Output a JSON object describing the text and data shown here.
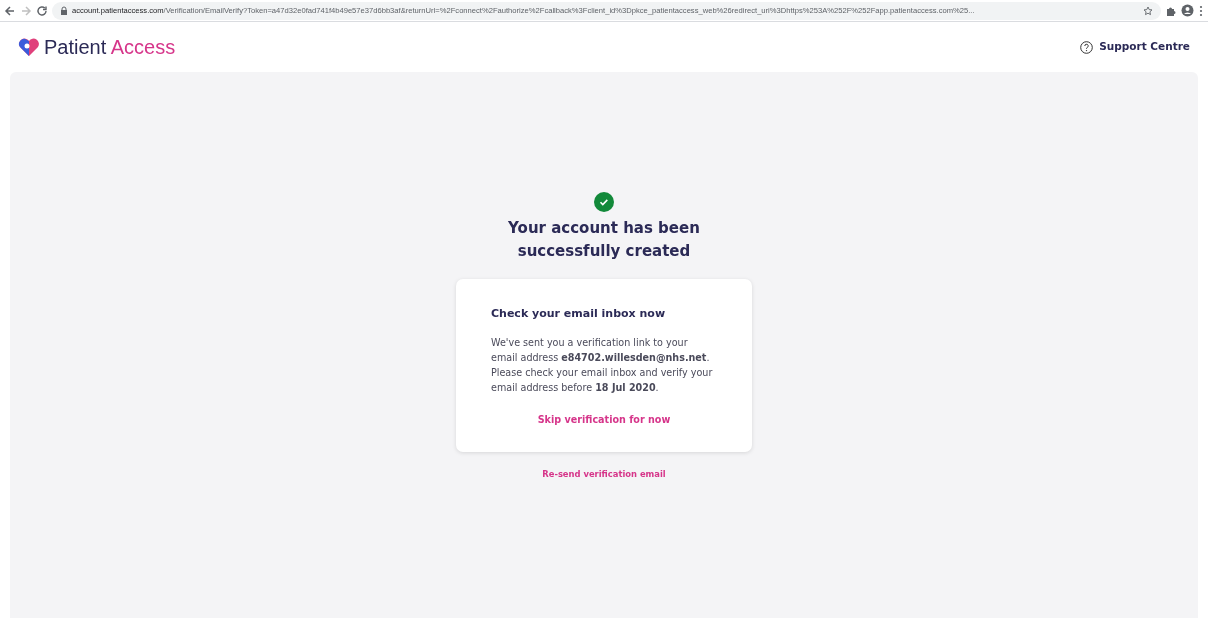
{
  "browser": {
    "url_host": "account.patientaccess.com",
    "url_path": "/Verification/EmailVerify?Token=a47d32e0fad741f4b49e57e37d6bb3af&returnUrl=%2Fconnect%2Fauthorize%2Fcallback%3Fclient_id%3Dpkce_patientaccess_web%26redirect_uri%3Dhttps%253A%252F%252Fapp.patientaccess.com%25..."
  },
  "header": {
    "logo_first": "Patient",
    "logo_second": "Access",
    "support_link": "Support Centre"
  },
  "main": {
    "title_line_1": "Your account has been",
    "title_line_2": "successfully created",
    "card": {
      "heading": "Check your email inbox now",
      "body": "We've sent you a verification link to your email address **e84702.willesden@nhs.net**. Please check your email inbox and verify your email address before **18 Jul 2020**.",
      "skip_link": "Skip verification for now"
    },
    "resend_link": "Re-send verification email"
  }
}
